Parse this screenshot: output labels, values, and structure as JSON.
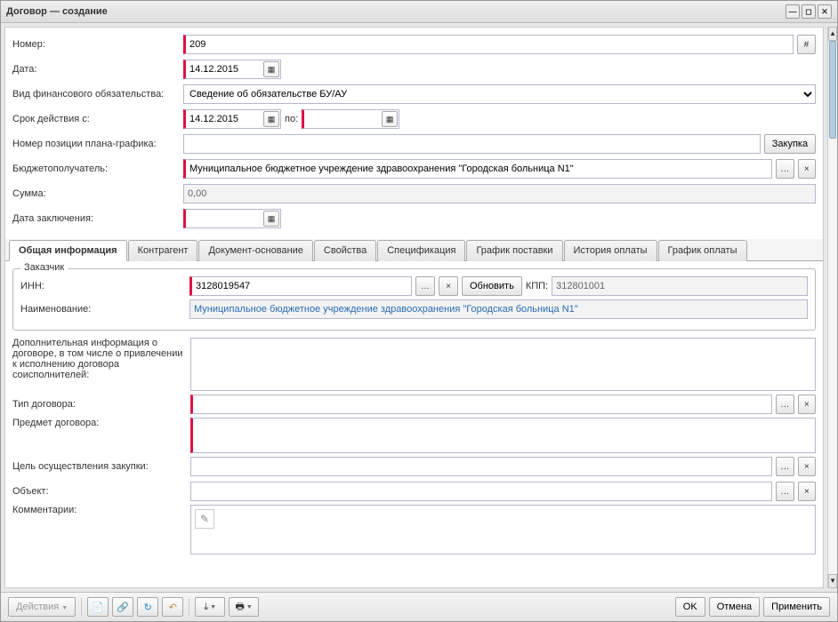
{
  "title": "Договор — создание",
  "labels": {
    "number": "Номер:",
    "date": "Дата:",
    "obligationType": "Вид финансового обязательства:",
    "validFrom": "Срок действия с:",
    "to": "по:",
    "planPosition": "Номер позиции плана-графика:",
    "purchase": "Закупка",
    "recipient": "Бюджетополучатель:",
    "sum": "Сумма:",
    "conclusionDate": "Дата заключения:"
  },
  "values": {
    "number": "209",
    "date": "14.12.2015",
    "obligationType": "Сведение об обязательстве БУ/АУ",
    "validFrom": "14.12.2015",
    "validTo": "",
    "planPosition": "",
    "recipient": "Муниципальное бюджетное учреждение здравоохранения \"Городская больница N1\"",
    "sum": "0,00",
    "conclusionDate": ""
  },
  "tabs": [
    "Общая информация",
    "Контрагент",
    "Документ-основание",
    "Свойства",
    "Спецификация",
    "График поставки",
    "История оплаты",
    "График оплаты"
  ],
  "customer": {
    "legend": "Заказчик",
    "innLabel": "ИНН:",
    "inn": "3128019547",
    "refresh": "Обновить",
    "kppLabel": "КПП:",
    "kpp": "312801001",
    "nameLabel": "Наименование:",
    "name": "Муниципальное бюджетное учреждение здравоохранения \"Городская больница N1\""
  },
  "general": {
    "extraInfoLabel": "Дополнительная информация о договоре, в том числе о привлечении к исполнению договора соисполнителей:",
    "contractTypeLabel": "Тип договора:",
    "subjectLabel": "Предмет договора:",
    "purposeLabel": "Цель осуществления закупки:",
    "objectLabel": "Объект:",
    "commentsLabel": "Комментарии:"
  },
  "footer": {
    "actions": "Действия",
    "ok": "OK",
    "cancel": "Отмена",
    "apply": "Применить"
  }
}
